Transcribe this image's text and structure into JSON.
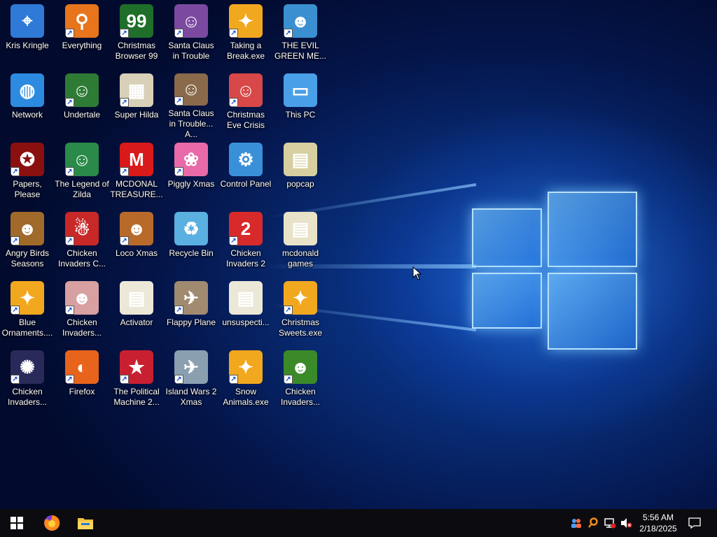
{
  "desktop": {
    "icons": [
      {
        "label": "Kris Kringle",
        "glyph": "⌖",
        "color": "#2e7ad6",
        "shortcut": false
      },
      {
        "label": "Everything",
        "glyph": "⚲",
        "color": "#e8741c",
        "shortcut": true
      },
      {
        "label": "Christmas Browser 99",
        "glyph": "99",
        "color": "#1f6e2a",
        "shortcut": true
      },
      {
        "label": "Santa Claus in Trouble",
        "glyph": "☺",
        "color": "#7b4aa0",
        "shortcut": true
      },
      {
        "label": "Taking a Break.exe",
        "glyph": "✦",
        "color": "#f2a81e",
        "shortcut": true
      },
      {
        "label": "THE EVIL GREEN ME...",
        "glyph": "☻",
        "color": "#3a8fd0",
        "shortcut": true
      },
      {
        "label": "Network",
        "glyph": "◍",
        "color": "#2c8be0",
        "shortcut": false
      },
      {
        "label": "Undertale",
        "glyph": "☺",
        "color": "#2e7b36",
        "shortcut": true
      },
      {
        "label": "Super Hilda",
        "glyph": "▦",
        "color": "#d8d0b8",
        "shortcut": true
      },
      {
        "label": "Santa Claus in Trouble... A...",
        "glyph": "☺",
        "color": "#8a6a4a",
        "shortcut": true
      },
      {
        "label": "Christmas Eve Crisis",
        "glyph": "☺",
        "color": "#d84848",
        "shortcut": true
      },
      {
        "label": "This PC",
        "glyph": "▭",
        "color": "#4aa0e8",
        "shortcut": false
      },
      {
        "label": "Papers, Please",
        "glyph": "✪",
        "color": "#8a1010",
        "shortcut": true
      },
      {
        "label": "The Legend of Zilda",
        "glyph": "☺",
        "color": "#2a8a4a",
        "shortcut": true
      },
      {
        "label": "MCDONAL TREASURE...",
        "glyph": "M",
        "color": "#d81a1a",
        "shortcut": true
      },
      {
        "label": "Piggly Xmas",
        "glyph": "❀",
        "color": "#e86aa8",
        "shortcut": true
      },
      {
        "label": "Control Panel",
        "glyph": "⚙",
        "color": "#3a90d8",
        "shortcut": false
      },
      {
        "label": "popcap",
        "glyph": "▤",
        "color": "#d8cfa0",
        "shortcut": false
      },
      {
        "label": "Angry Birds Seasons",
        "glyph": "☻",
        "color": "#a06a2a",
        "shortcut": true
      },
      {
        "label": "Chicken Invaders C...",
        "glyph": "☃",
        "color": "#c82828",
        "shortcut": true
      },
      {
        "label": "Loco Xmas",
        "glyph": "☻",
        "color": "#b86a2a",
        "shortcut": true
      },
      {
        "label": "Recycle Bin",
        "glyph": "♻",
        "color": "#5ab0e0",
        "shortcut": false
      },
      {
        "label": "Chicken Invaders 2",
        "glyph": "2",
        "color": "#d82a2a",
        "shortcut": true
      },
      {
        "label": "mcdonald games",
        "glyph": "▤",
        "color": "#e8e2c8",
        "shortcut": false
      },
      {
        "label": "Blue Ornaments....",
        "glyph": "✦",
        "color": "#f2a81e",
        "shortcut": true
      },
      {
        "label": "Chicken Invaders...",
        "glyph": "☻",
        "color": "#d8a0a0",
        "shortcut": true
      },
      {
        "label": "Activator",
        "glyph": "▤",
        "color": "#ece8d8",
        "shortcut": false
      },
      {
        "label": "Flappy Plane",
        "glyph": "✈",
        "color": "#a08a70",
        "shortcut": true
      },
      {
        "label": "unsuspecti...",
        "glyph": "▤",
        "color": "#ece8d8",
        "shortcut": false
      },
      {
        "label": "Christmas Sweets.exe",
        "glyph": "✦",
        "color": "#f2a81e",
        "shortcut": true
      },
      {
        "label": "Chicken Invaders...",
        "glyph": "✺",
        "color": "#2a2a5a",
        "shortcut": true
      },
      {
        "label": "Firefox",
        "glyph": "◐",
        "color": "#e8641c",
        "shortcut": true
      },
      {
        "label": "The Political Machine 2...",
        "glyph": "★",
        "color": "#c82030",
        "shortcut": true
      },
      {
        "label": "Island Wars 2 Xmas",
        "glyph": "✈",
        "color": "#8aa0b0",
        "shortcut": true
      },
      {
        "label": "Snow Animals.exe",
        "glyph": "✦",
        "color": "#f2a81e",
        "shortcut": true
      },
      {
        "label": "Chicken Invaders...",
        "glyph": "☻",
        "color": "#3a8a2a",
        "shortcut": true
      }
    ]
  },
  "taskbar": {
    "start_icon": "windows-logo-icon",
    "pinned": [
      {
        "name": "firefox-icon"
      },
      {
        "name": "file-explorer-icon"
      }
    ],
    "tray": {
      "icons": [
        "people-icon",
        "search-icon",
        "network-icon",
        "volume-muted-icon"
      ],
      "time": "5:56 AM",
      "date": "2/18/2025",
      "notification_icon": "action-center-icon"
    }
  },
  "colors": {
    "taskbar": "#0c0c10",
    "wallpaper_accent": "#1e6fe0"
  }
}
